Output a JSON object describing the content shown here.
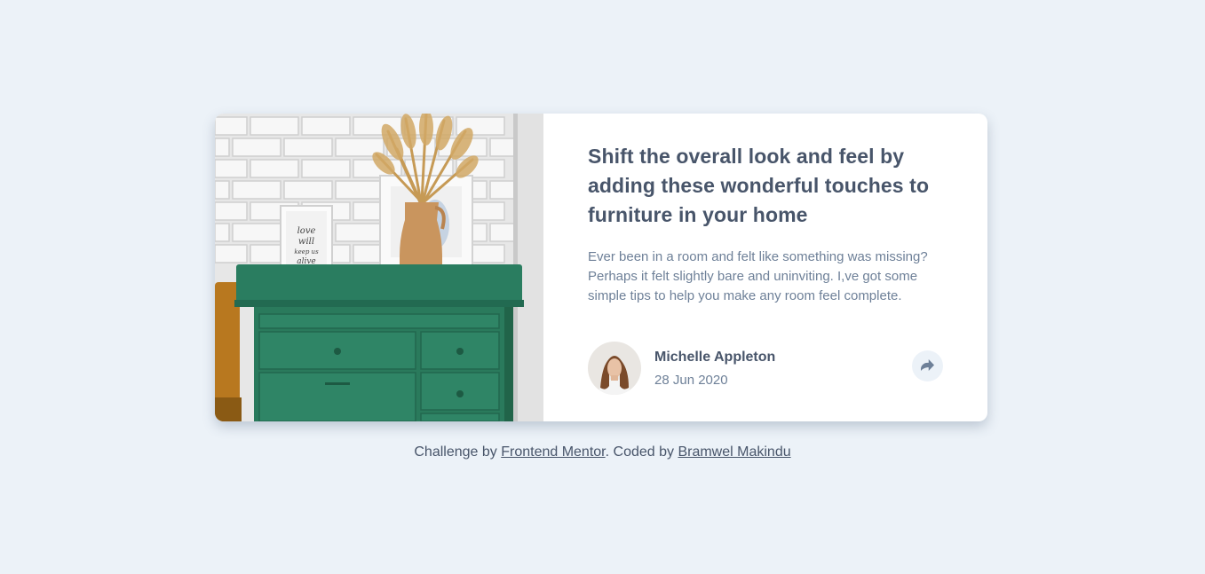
{
  "card": {
    "title": "Shift the overall look and feel by adding these wonderful touches to furniture in your home",
    "description": "Ever been in a room and felt like something was missing? Perhaps it felt slightly bare and uninviting. I,ve got some simple tips to help you make any room feel complete.",
    "photo_frame_text": "love will keep us alive",
    "author": {
      "name": "Michelle Appleton",
      "date": "28 Jun 2020"
    },
    "share_icon": "share-arrow-icon"
  },
  "footer": {
    "prefix": "Challenge by ",
    "link1": "Frontend Mentor",
    "middle": ". Coded by ",
    "link2": "Bramwel Makindu"
  },
  "colors": {
    "background": "#ecf2f8",
    "heading": "#48556a",
    "body_text": "#6e8098",
    "card": "#ffffff"
  }
}
